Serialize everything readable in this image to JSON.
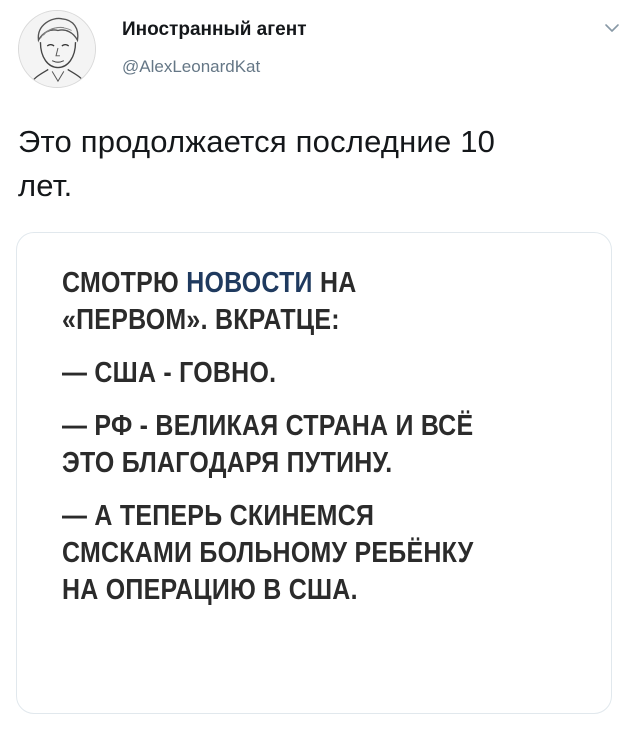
{
  "header": {
    "display_name": "Иностранный агент",
    "handle": "@AlexLeonardKat"
  },
  "tweet": {
    "text_line1": "Это продолжается последние 10",
    "text_line2": "лет."
  },
  "card": {
    "meme": {
      "line1_a": "СМОТРЮ ",
      "line1_highlight": "НОВОСТИ",
      "line1_b": " НА",
      "line2": "«ПЕРВОМ». ВКРАТЦЕ:",
      "line3": "— США - ГОВНО.",
      "line4": "— РФ - ВЕЛИКАЯ СТРАНА И ВСЁ",
      "line5": "ЭТО БЛАГОДАРЯ ПУТИНУ.",
      "line6": "— А ТЕПЕРЬ СКИНЕМСЯ",
      "line7": "СМСКАМИ БОЛЬНОМУ РЕБЁНКУ",
      "line8": "НА ОПЕРАЦИЮ В США."
    }
  },
  "icons": {
    "avatar": "user-photo-avatar",
    "caret": "chevron-down-icon"
  },
  "colors": {
    "text": "#14171a",
    "secondary": "#657786",
    "border": "#e1e8ed",
    "meme_highlight": "#1f3a5f"
  }
}
